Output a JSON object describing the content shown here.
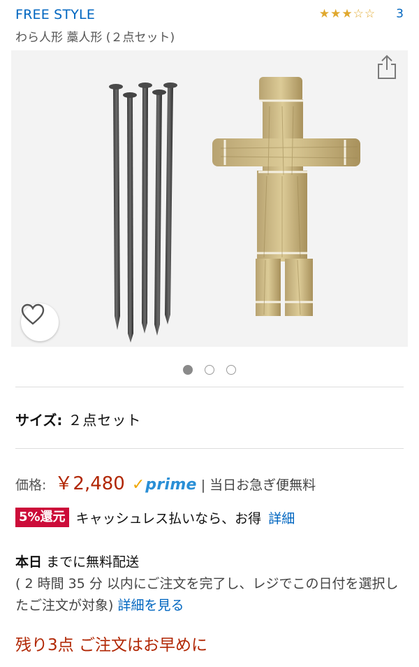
{
  "brand": "FREE STYLE",
  "rating": {
    "stars": [
      1,
      1,
      1,
      0,
      0
    ],
    "count": "3"
  },
  "title": "わら人形 藁人形 (２点セット)",
  "image": {
    "description_icons": [
      "share-icon",
      "heart-icon"
    ]
  },
  "carousel": {
    "pages": 3,
    "active": 0
  },
  "size": {
    "label": "サイズ:",
    "value": "２点セット"
  },
  "price": {
    "label": "価格:",
    "value": "￥2,480",
    "prime_check": "✓",
    "prime_text": "prime",
    "separator": "|",
    "shipping": "当日お急ぎ便無料"
  },
  "cashback": {
    "badge": "5%還元",
    "text": "キャッシュレス払いなら、お得",
    "link": "詳細"
  },
  "delivery": {
    "today": "本日",
    "title_rest": "までに無料配送",
    "note": "( 2 時間 35 分 以内にご注文を完了し、レジでこの日付を選択したご注文が対象)",
    "link": "詳細を見る"
  },
  "stock": "残り3点 ご注文はお早めに",
  "colors": {
    "link": "#0066c0",
    "price": "#b12704",
    "badge": "#cc0c39",
    "prime": "#2a8fd6",
    "star": "#e0a82e"
  }
}
